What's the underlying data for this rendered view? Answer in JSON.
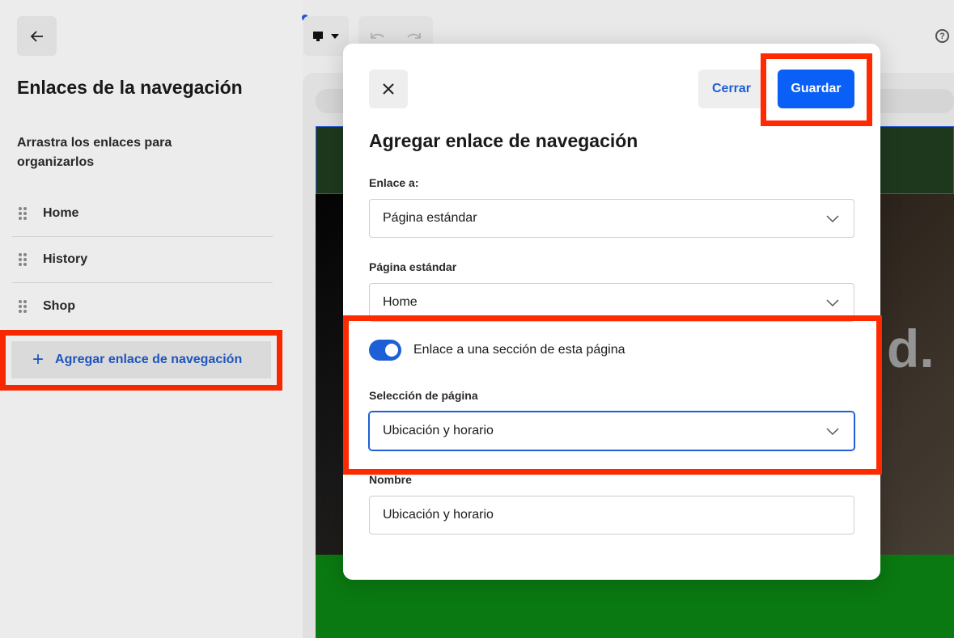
{
  "sidebar": {
    "title": "Enlaces de la navegación",
    "hint": "Arrastra los enlaces para organizarlos",
    "items": [
      {
        "label": "Home"
      },
      {
        "label": "History"
      },
      {
        "label": "Shop"
      }
    ],
    "add_link_label": "Agregar enlace de navegación"
  },
  "toolbar": {
    "device_icon": "desktop-icon",
    "undo_icon": "undo-icon",
    "redo_icon": "redo-icon",
    "help_icon": "help-icon"
  },
  "preview": {
    "hero_text": "d."
  },
  "modal": {
    "title": "Agregar enlace de navegación",
    "close_label": "Cerrar",
    "save_label": "Guardar",
    "link_to": {
      "label": "Enlace a:",
      "value": "Página estándar"
    },
    "standard_page": {
      "label": "Página estándar",
      "value": "Home"
    },
    "section_toggle": {
      "label": "Enlace a una sección de esta página",
      "on": true
    },
    "page_selection": {
      "label": "Selección de página",
      "value": "Ubicación y horario"
    },
    "name": {
      "label": "Nombre",
      "value": "Ubicación y horario"
    }
  },
  "colors": {
    "accent": "#0a5ff6",
    "highlight": "#ff2a00",
    "link": "#1d5fd6"
  }
}
